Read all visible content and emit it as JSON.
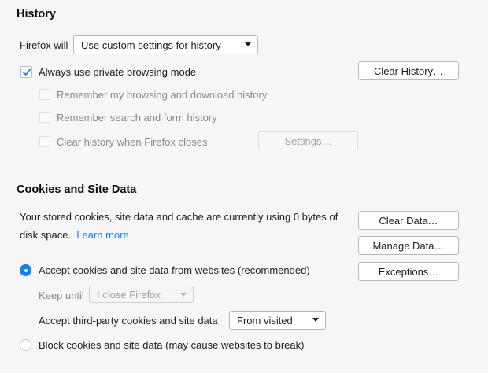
{
  "history": {
    "title": "History",
    "firefox_will_label": "Firefox will",
    "mode_select": "Use custom settings for history",
    "always_private": "Always use private browsing mode",
    "clear_history_button": "Clear History…",
    "remember_browsing": "Remember my browsing and download history",
    "remember_search": "Remember search and form history",
    "clear_on_close": "Clear history when Firefox closes",
    "settings_button": "Settings…"
  },
  "cookies": {
    "title": "Cookies and Site Data",
    "usage_text_line1": "Your stored cookies, site data and cache are currently using 0 bytes of",
    "usage_text_line2": "disk space.",
    "learn_more": "Learn more",
    "clear_data_button": "Clear Data…",
    "manage_data_button": "Manage Data…",
    "exceptions_button": "Exceptions…",
    "accept_cookies": "Accept cookies and site data from websites (recommended)",
    "keep_until_label": "Keep until",
    "keep_until_select": "I close Firefox",
    "third_party_label": "Accept third-party cookies and site data",
    "third_party_select": "From visited",
    "block_cookies": "Block cookies and site data (may cause websites to break)"
  },
  "colors": {
    "accent": "#0a84ff",
    "background": "#f6f6f7"
  }
}
